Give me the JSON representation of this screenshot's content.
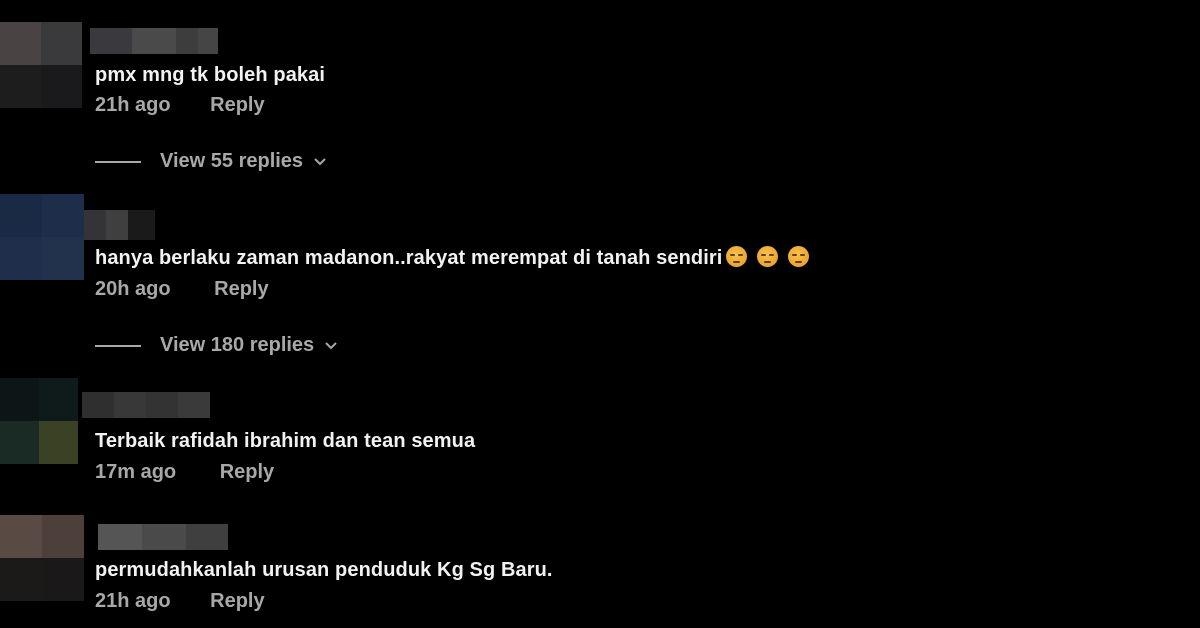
{
  "comments": [
    {
      "text": "pmx mng tk boleh pakai",
      "time": "21h ago",
      "reply_label": "Reply",
      "view_replies": "View 55 replies",
      "avatar_colors": [
        "#4a4344",
        "#3a3a3c",
        "#1d1d1d",
        "#1a1a1c"
      ],
      "username_colors": [
        "#3a3a3e",
        "#4a4a4a",
        "#3d3d3d",
        "#454545"
      ]
    },
    {
      "text": "hanya berlaku zaman madanon..rakyat merempat di tanah sendiri",
      "emojis": [
        "pensive-face-emoji",
        "pensive-face-emoji",
        "pensive-face-emoji"
      ],
      "time": "20h ago",
      "reply_label": "Reply",
      "view_replies": "View 180 replies",
      "avatar_colors": [
        "#1a2a45",
        "#1d2d4a",
        "#1f2f4b",
        "#22314c"
      ],
      "username_colors": [
        "#343436",
        "#3f3f3f",
        "#1a1a1a"
      ]
    },
    {
      "text": "Terbaik rafidah ibrahim dan tean semua",
      "time": "17m ago",
      "reply_label": "Reply",
      "avatar_colors": [
        "#0c1617",
        "#0f1a1b",
        "#1a2b26",
        "#3a4125"
      ],
      "username_colors": [
        "#2f2f2f",
        "#383838",
        "#333333",
        "#3a3a3a"
      ]
    },
    {
      "text": "permudahkanlah urusan penduduk Kg Sg Baru.",
      "time": "21h ago",
      "reply_label": "Reply",
      "avatar_colors": [
        "#5a4a44",
        "#4d3f3a",
        "#1c1a19",
        "#1a1818"
      ],
      "username_colors": [
        "#555555",
        "#4a4a4a",
        "#3f3f3f"
      ]
    }
  ]
}
